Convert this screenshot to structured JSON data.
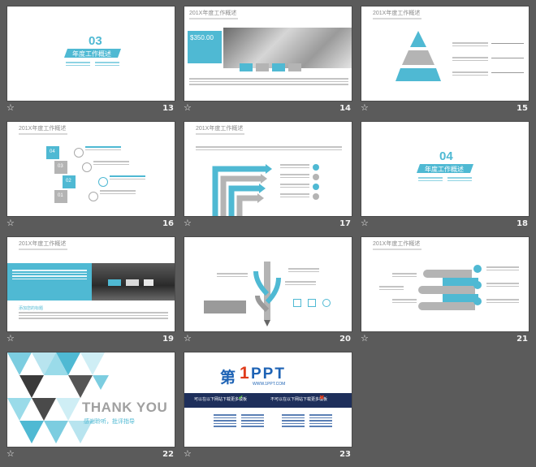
{
  "colors": {
    "accent": "#4fb9d3",
    "background": "#5b5b5b",
    "grey": "#b4b4b4",
    "dark_navy": "#1e2f5b"
  },
  "slides": [
    {
      "number": "13",
      "section_no": "03",
      "section_title": "年度工作概述"
    },
    {
      "number": "14",
      "title": "201X年度工作概述",
      "price": "$350.00",
      "tags": [
        "文字",
        "文字",
        "文字",
        "文字"
      ]
    },
    {
      "number": "15",
      "title": "201X年度工作概述"
    },
    {
      "number": "16",
      "title": "201X年度工作概述",
      "steps": [
        "04",
        "03",
        "02",
        "01"
      ]
    },
    {
      "number": "17",
      "title": "201X年度工作概述"
    },
    {
      "number": "18",
      "section_no": "04",
      "section_title": "年度工作概述"
    },
    {
      "number": "19",
      "title": "201X年度工作概述",
      "caption": "添加您的标题"
    },
    {
      "number": "20",
      "title": ""
    },
    {
      "number": "21",
      "title": "201X年度工作概述"
    },
    {
      "number": "22",
      "thanks": "THANK YOU",
      "thanks_sub": "感谢聆听，批评指导"
    },
    {
      "number": "23",
      "logo_char": "第",
      "logo_num": "1",
      "logo_ppt": "PPT",
      "logo_url": "WWW.1PPT.COM",
      "bar_left": "可以在以下网站下载更多模板",
      "bar_right": "不可以在以下网站下载更多模板"
    }
  ]
}
